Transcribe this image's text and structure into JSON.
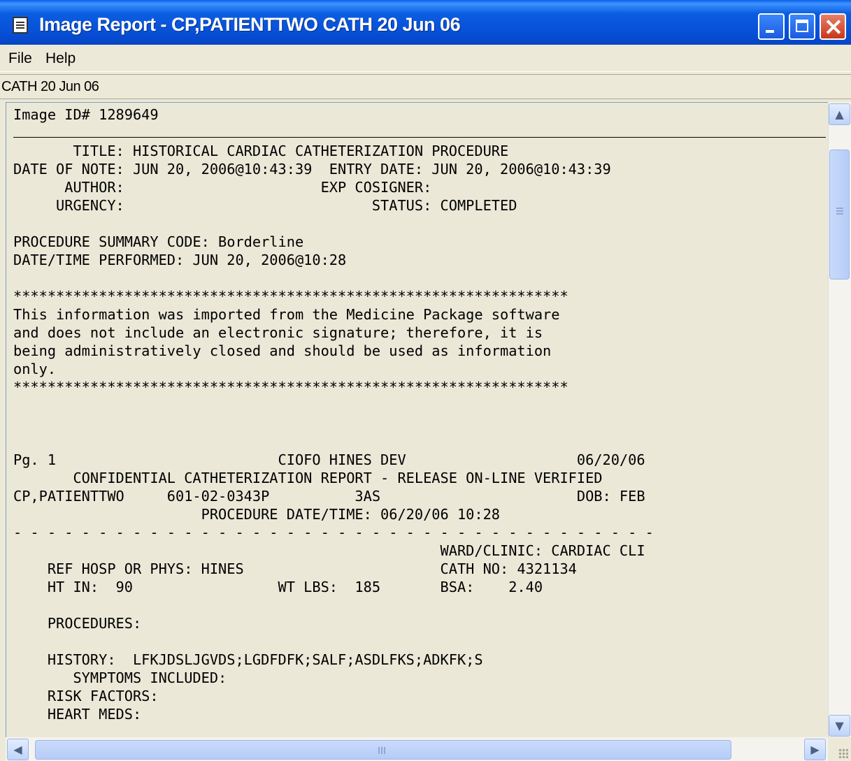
{
  "window": {
    "title": "Image Report - CP,PATIENTTWO CATH  20 Jun 06",
    "icon": "document-icon",
    "buttons": [
      "minimize",
      "maximize",
      "close"
    ],
    "colors": {
      "titlebar": "#0A5FE8",
      "close_button": "#D8482A",
      "background": "#ECE9D8"
    }
  },
  "menu": {
    "items": [
      "File",
      "Help"
    ]
  },
  "subheader": {
    "label": "CATH  20 Jun 06"
  },
  "report": {
    "image_id": "Image ID# 1289649",
    "lines": [
      "       TITLE: HISTORICAL CARDIAC CATHETERIZATION PROCEDURE",
      "DATE OF NOTE: JUN 20, 2006@10:43:39  ENTRY DATE: JUN 20, 2006@10:43:39",
      "      AUTHOR:                       EXP COSIGNER:",
      "     URGENCY:                             STATUS: COMPLETED",
      "",
      "PROCEDURE SUMMARY CODE: Borderline",
      "DATE/TIME PERFORMED: JUN 20, 2006@10:28",
      "",
      "*****************************************************************",
      "This information was imported from the Medicine Package software",
      "and does not include an electronic signature; therefore, it is",
      "being administratively closed and should be used as information",
      "only.",
      "*****************************************************************",
      "",
      "",
      "",
      "Pg. 1                          CIOFO HINES DEV                    06/20/06",
      "       CONFIDENTIAL CATHETERIZATION REPORT - RELEASE ON-LINE VERIFIED",
      "CP,PATIENTTWO     601-02-0343P          3AS                       DOB: FEB",
      "                      PROCEDURE DATE/TIME: 06/20/06 10:28",
      "- - - - - - - - - - - - - - - - - - - - - - - - - - - - - - - - - - - - - -",
      "                                                  WARD/CLINIC: CARDIAC CLI",
      "    REF HOSP OR PHYS: HINES                       CATH NO: 4321134",
      "    HT IN:  90                 WT LBS:  185       BSA:    2.40",
      "",
      "    PROCEDURES:",
      "",
      "    HISTORY:  LFKJDSLJGVDS;LGDFDFK;SALF;ASDLFKS;ADKFK;S",
      "       SYMPTOMS INCLUDED:",
      "    RISK FACTORS:",
      "    HEART MEDS:"
    ]
  },
  "scrollbars": {
    "up_icon": "arrow-up-icon",
    "down_icon": "arrow-down-icon",
    "left_icon": "arrow-left-icon",
    "right_icon": "arrow-right-icon"
  }
}
